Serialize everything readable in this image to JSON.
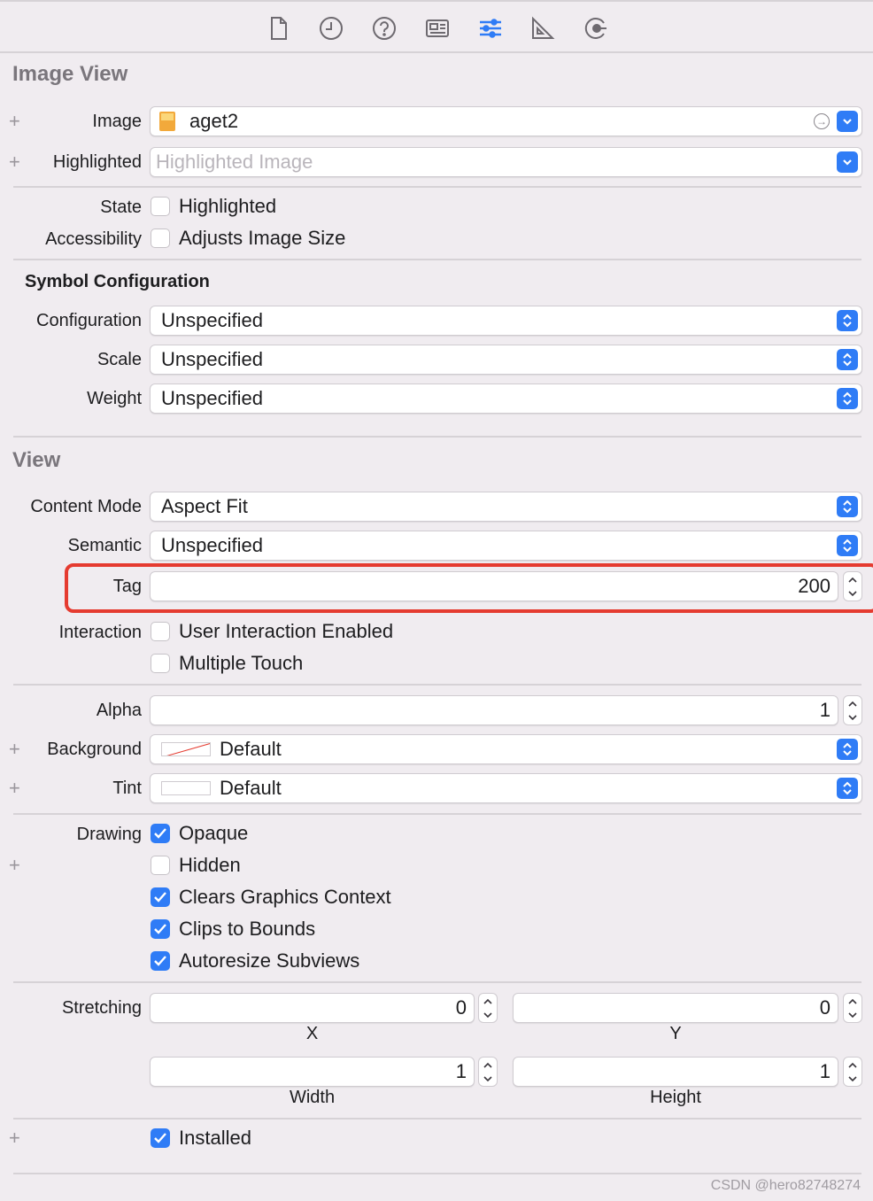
{
  "toolbar": {
    "icons": [
      "file-icon",
      "history-icon",
      "help-icon",
      "identity-icon",
      "attributes-icon",
      "size-icon",
      "connections-icon"
    ],
    "active": "attributes-icon",
    "accent": "#2f7cf6"
  },
  "image_view": {
    "title": "Image View",
    "image_label": "Image",
    "image_value": "aget2",
    "highlighted_label": "Highlighted",
    "highlighted_placeholder": "Highlighted Image",
    "state_label": "State",
    "state_option": "Highlighted",
    "state_checked": false,
    "accessibility_label": "Accessibility",
    "accessibility_option": "Adjusts Image Size",
    "accessibility_checked": false
  },
  "symbol_config": {
    "title": "Symbol Configuration",
    "configuration_label": "Configuration",
    "configuration_value": "Unspecified",
    "scale_label": "Scale",
    "scale_value": "Unspecified",
    "weight_label": "Weight",
    "weight_value": "Unspecified"
  },
  "view": {
    "title": "View",
    "content_mode_label": "Content Mode",
    "content_mode_value": "Aspect Fit",
    "semantic_label": "Semantic",
    "semantic_value": "Unspecified",
    "tag_label": "Tag",
    "tag_value": "200",
    "interaction_label": "Interaction",
    "user_interaction": "User Interaction Enabled",
    "multiple_touch": "Multiple Touch",
    "alpha_label": "Alpha",
    "alpha_value": "1",
    "background_label": "Background",
    "background_value": "Default",
    "tint_label": "Tint",
    "tint_value": "Default",
    "drawing_label": "Drawing",
    "opaque": "Opaque",
    "hidden": "Hidden",
    "clears_graphics": "Clears Graphics Context",
    "clips_to_bounds": "Clips to Bounds",
    "autoresize": "Autoresize Subviews",
    "stretching_label": "Stretching",
    "stretch_x": "0",
    "stretch_y": "0",
    "stretch_width": "1",
    "stretch_height": "1",
    "x_label": "X",
    "y_label": "Y",
    "width_label": "Width",
    "height_label": "Height",
    "installed": "Installed"
  },
  "watermark": "CSDN @hero82748274"
}
